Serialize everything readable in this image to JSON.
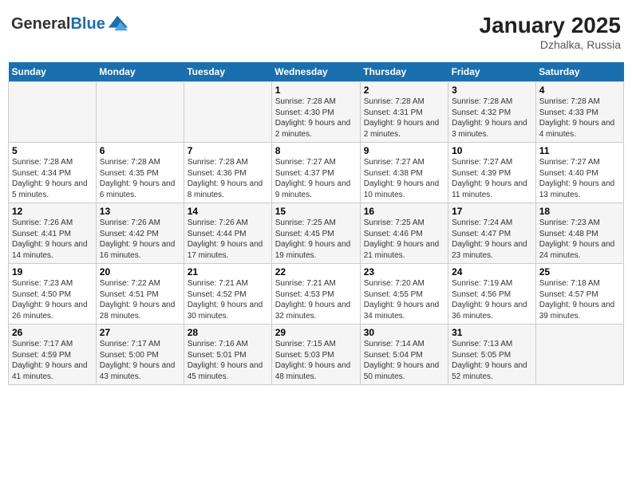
{
  "logo": {
    "text_general": "General",
    "text_blue": "Blue"
  },
  "title": "January 2025",
  "subtitle": "Dzhalka, Russia",
  "days_of_week": [
    "Sunday",
    "Monday",
    "Tuesday",
    "Wednesday",
    "Thursday",
    "Friday",
    "Saturday"
  ],
  "weeks": [
    [
      {
        "day": "",
        "info": ""
      },
      {
        "day": "",
        "info": ""
      },
      {
        "day": "",
        "info": ""
      },
      {
        "day": "1",
        "info": "Sunrise: 7:28 AM\nSunset: 4:30 PM\nDaylight: 9 hours and 2 minutes."
      },
      {
        "day": "2",
        "info": "Sunrise: 7:28 AM\nSunset: 4:31 PM\nDaylight: 9 hours and 2 minutes."
      },
      {
        "day": "3",
        "info": "Sunrise: 7:28 AM\nSunset: 4:32 PM\nDaylight: 9 hours and 3 minutes."
      },
      {
        "day": "4",
        "info": "Sunrise: 7:28 AM\nSunset: 4:33 PM\nDaylight: 9 hours and 4 minutes."
      }
    ],
    [
      {
        "day": "5",
        "info": "Sunrise: 7:28 AM\nSunset: 4:34 PM\nDaylight: 9 hours and 5 minutes."
      },
      {
        "day": "6",
        "info": "Sunrise: 7:28 AM\nSunset: 4:35 PM\nDaylight: 9 hours and 6 minutes."
      },
      {
        "day": "7",
        "info": "Sunrise: 7:28 AM\nSunset: 4:36 PM\nDaylight: 9 hours and 8 minutes."
      },
      {
        "day": "8",
        "info": "Sunrise: 7:27 AM\nSunset: 4:37 PM\nDaylight: 9 hours and 9 minutes."
      },
      {
        "day": "9",
        "info": "Sunrise: 7:27 AM\nSunset: 4:38 PM\nDaylight: 9 hours and 10 minutes."
      },
      {
        "day": "10",
        "info": "Sunrise: 7:27 AM\nSunset: 4:39 PM\nDaylight: 9 hours and 11 minutes."
      },
      {
        "day": "11",
        "info": "Sunrise: 7:27 AM\nSunset: 4:40 PM\nDaylight: 9 hours and 13 minutes."
      }
    ],
    [
      {
        "day": "12",
        "info": "Sunrise: 7:26 AM\nSunset: 4:41 PM\nDaylight: 9 hours and 14 minutes."
      },
      {
        "day": "13",
        "info": "Sunrise: 7:26 AM\nSunset: 4:42 PM\nDaylight: 9 hours and 16 minutes."
      },
      {
        "day": "14",
        "info": "Sunrise: 7:26 AM\nSunset: 4:44 PM\nDaylight: 9 hours and 17 minutes."
      },
      {
        "day": "15",
        "info": "Sunrise: 7:25 AM\nSunset: 4:45 PM\nDaylight: 9 hours and 19 minutes."
      },
      {
        "day": "16",
        "info": "Sunrise: 7:25 AM\nSunset: 4:46 PM\nDaylight: 9 hours and 21 minutes."
      },
      {
        "day": "17",
        "info": "Sunrise: 7:24 AM\nSunset: 4:47 PM\nDaylight: 9 hours and 23 minutes."
      },
      {
        "day": "18",
        "info": "Sunrise: 7:23 AM\nSunset: 4:48 PM\nDaylight: 9 hours and 24 minutes."
      }
    ],
    [
      {
        "day": "19",
        "info": "Sunrise: 7:23 AM\nSunset: 4:50 PM\nDaylight: 9 hours and 26 minutes."
      },
      {
        "day": "20",
        "info": "Sunrise: 7:22 AM\nSunset: 4:51 PM\nDaylight: 9 hours and 28 minutes."
      },
      {
        "day": "21",
        "info": "Sunrise: 7:21 AM\nSunset: 4:52 PM\nDaylight: 9 hours and 30 minutes."
      },
      {
        "day": "22",
        "info": "Sunrise: 7:21 AM\nSunset: 4:53 PM\nDaylight: 9 hours and 32 minutes."
      },
      {
        "day": "23",
        "info": "Sunrise: 7:20 AM\nSunset: 4:55 PM\nDaylight: 9 hours and 34 minutes."
      },
      {
        "day": "24",
        "info": "Sunrise: 7:19 AM\nSunset: 4:56 PM\nDaylight: 9 hours and 36 minutes."
      },
      {
        "day": "25",
        "info": "Sunrise: 7:18 AM\nSunset: 4:57 PM\nDaylight: 9 hours and 39 minutes."
      }
    ],
    [
      {
        "day": "26",
        "info": "Sunrise: 7:17 AM\nSunset: 4:59 PM\nDaylight: 9 hours and 41 minutes."
      },
      {
        "day": "27",
        "info": "Sunrise: 7:17 AM\nSunset: 5:00 PM\nDaylight: 9 hours and 43 minutes."
      },
      {
        "day": "28",
        "info": "Sunrise: 7:16 AM\nSunset: 5:01 PM\nDaylight: 9 hours and 45 minutes."
      },
      {
        "day": "29",
        "info": "Sunrise: 7:15 AM\nSunset: 5:03 PM\nDaylight: 9 hours and 48 minutes."
      },
      {
        "day": "30",
        "info": "Sunrise: 7:14 AM\nSunset: 5:04 PM\nDaylight: 9 hours and 50 minutes."
      },
      {
        "day": "31",
        "info": "Sunrise: 7:13 AM\nSunset: 5:05 PM\nDaylight: 9 hours and 52 minutes."
      },
      {
        "day": "",
        "info": ""
      }
    ]
  ]
}
